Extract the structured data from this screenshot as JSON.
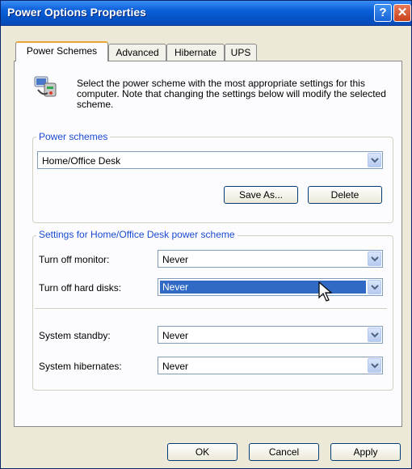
{
  "window": {
    "title": "Power Options Properties"
  },
  "title_buttons": {
    "help": "?",
    "close": "✕"
  },
  "tabs": [
    {
      "label": "Power Schemes",
      "active": true
    },
    {
      "label": "Advanced",
      "active": false
    },
    {
      "label": "Hibernate",
      "active": false
    },
    {
      "label": "UPS",
      "active": false
    }
  ],
  "intro": {
    "text": "Select the power scheme with the most appropriate settings for this computer. Note that changing the settings below will modify the selected scheme.",
    "icon": "power-options-icon"
  },
  "power_schemes": {
    "label": "Power schemes",
    "selected": "Home/Office Desk",
    "save_as_label": "Save As...",
    "delete_label": "Delete"
  },
  "settings": {
    "label": "Settings for Home/Office Desk power scheme",
    "rows": [
      {
        "label": "Turn off monitor:",
        "value": "Never"
      },
      {
        "label": "Turn off hard disks:",
        "value": "Never"
      },
      {
        "label": "System standby:",
        "value": "Never"
      },
      {
        "label": "System hibernates:",
        "value": "Never"
      }
    ]
  },
  "footer": {
    "ok_label": "OK",
    "cancel_label": "Cancel",
    "apply_label": "Apply"
  },
  "colors": {
    "title_blue": "#0453c8",
    "group_label": "#1a4bd0",
    "selection": "#316ac5",
    "tab_highlight": "#e9a53a"
  }
}
